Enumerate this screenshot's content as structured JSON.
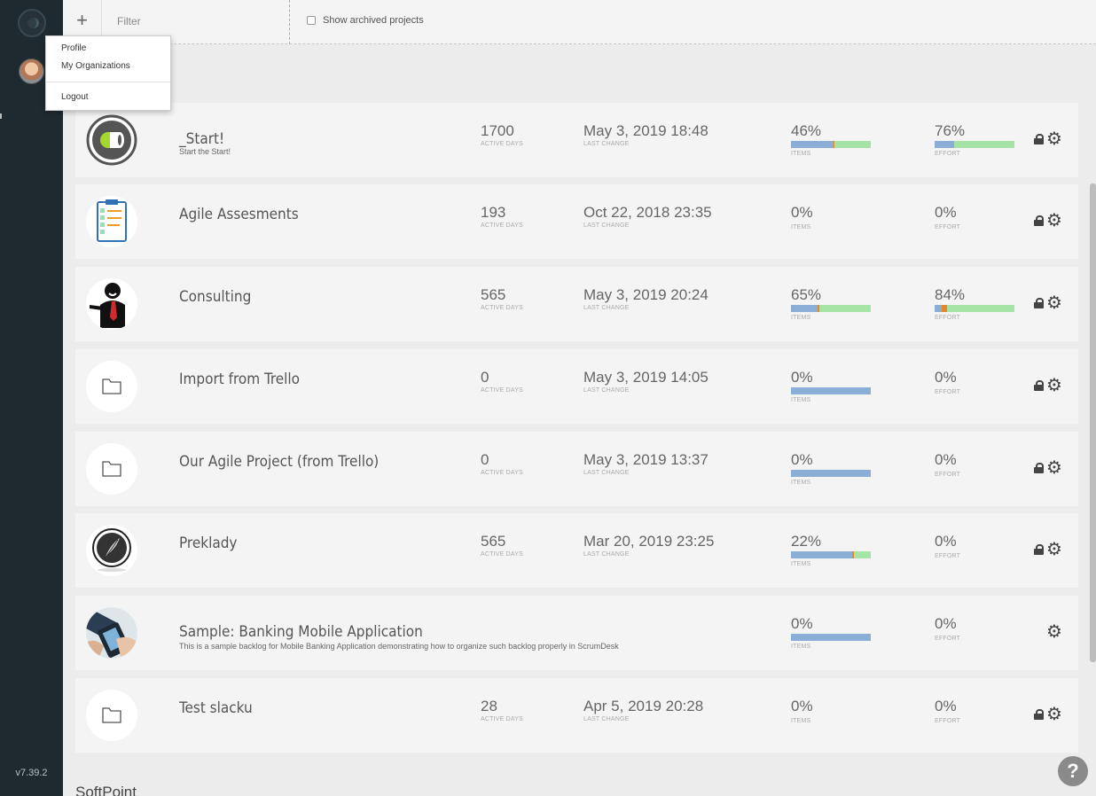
{
  "sidebar": {
    "version": "v7.39.2"
  },
  "toolbar": {
    "add_label": "+",
    "filter_placeholder": "Filter",
    "show_archived_label": "Show archived projects"
  },
  "user_menu": {
    "profile": "Profile",
    "organizations": "My Organizations",
    "logout": "Logout"
  },
  "labels": {
    "active_days": "ACTIVE DAYS",
    "last_change": "LAST CHANGE",
    "items": "ITEMS",
    "effort": "EFFORT"
  },
  "colors": {
    "bar_blue": "#8aaed6",
    "bar_green": "#a6e4a6",
    "bar_orange": "#e8862a",
    "sidebar": "#1f2a30"
  },
  "projects": [
    {
      "name": "_Start!",
      "description": "Start the Start!",
      "active_days": "1700",
      "last_change": "May 3, 2019 18:48",
      "items_pct": "46%",
      "effort_pct": "76%",
      "icon": "start-logo-icon",
      "locked": true,
      "items_bar": [
        0.53,
        0.02,
        0.45
      ],
      "effort_bar": [
        0.24,
        0.0,
        0.76
      ]
    },
    {
      "name": "Agile Assesments",
      "description": "",
      "active_days": "193",
      "last_change": "Oct 22, 2018 23:35",
      "items_pct": "0%",
      "effort_pct": "0%",
      "icon": "clipboard-icon",
      "locked": true,
      "items_bar": null,
      "effort_bar": null
    },
    {
      "name": "Consulting",
      "description": "",
      "active_days": "565",
      "last_change": "May 3, 2019 20:24",
      "items_pct": "65%",
      "effort_pct": "84%",
      "icon": "consultant-icon",
      "locked": true,
      "items_bar": [
        0.33,
        0.03,
        0.64
      ],
      "effort_bar": [
        0.09,
        0.07,
        0.84
      ]
    },
    {
      "name": "Import from Trello",
      "description": "",
      "active_days": "0",
      "last_change": "May 3, 2019 14:05",
      "items_pct": "0%",
      "effort_pct": "0%",
      "icon": "folder-icon",
      "locked": true,
      "items_bar": [
        1.0,
        0.0,
        0.0
      ],
      "effort_bar": null
    },
    {
      "name": "Our Agile Project (from Trello)",
      "description": "",
      "active_days": "0",
      "last_change": "May 3, 2019 13:37",
      "items_pct": "0%",
      "effort_pct": "0%",
      "icon": "folder-icon",
      "locked": true,
      "items_bar": [
        1.0,
        0.0,
        0.0
      ],
      "effort_bar": null
    },
    {
      "name": "Preklady",
      "description": "",
      "active_days": "565",
      "last_change": "Mar 20, 2019 23:25",
      "items_pct": "22%",
      "effort_pct": "0%",
      "icon": "quill-icon",
      "locked": true,
      "items_bar": [
        0.77,
        0.02,
        0.21
      ],
      "effort_bar": null
    },
    {
      "name": "Sample: Banking Mobile Application",
      "description": "This is a sample backlog for Mobile Banking Application demonstrating how to organize such backlog properly in ScrumDesk",
      "active_days": "",
      "last_change": "",
      "items_pct": "0%",
      "effort_pct": "0%",
      "icon": "banking-photo-icon",
      "locked": false,
      "items_bar": [
        1.0,
        0.0,
        0.0
      ],
      "effort_bar": null
    },
    {
      "name": "Test slacku",
      "description": "",
      "active_days": "28",
      "last_change": "Apr 5, 2019 20:28",
      "items_pct": "0%",
      "effort_pct": "0%",
      "icon": "folder-icon",
      "locked": true,
      "items_bar": null,
      "effort_bar": null
    }
  ],
  "next_section_title": "SoftPoint",
  "help_label": "?"
}
